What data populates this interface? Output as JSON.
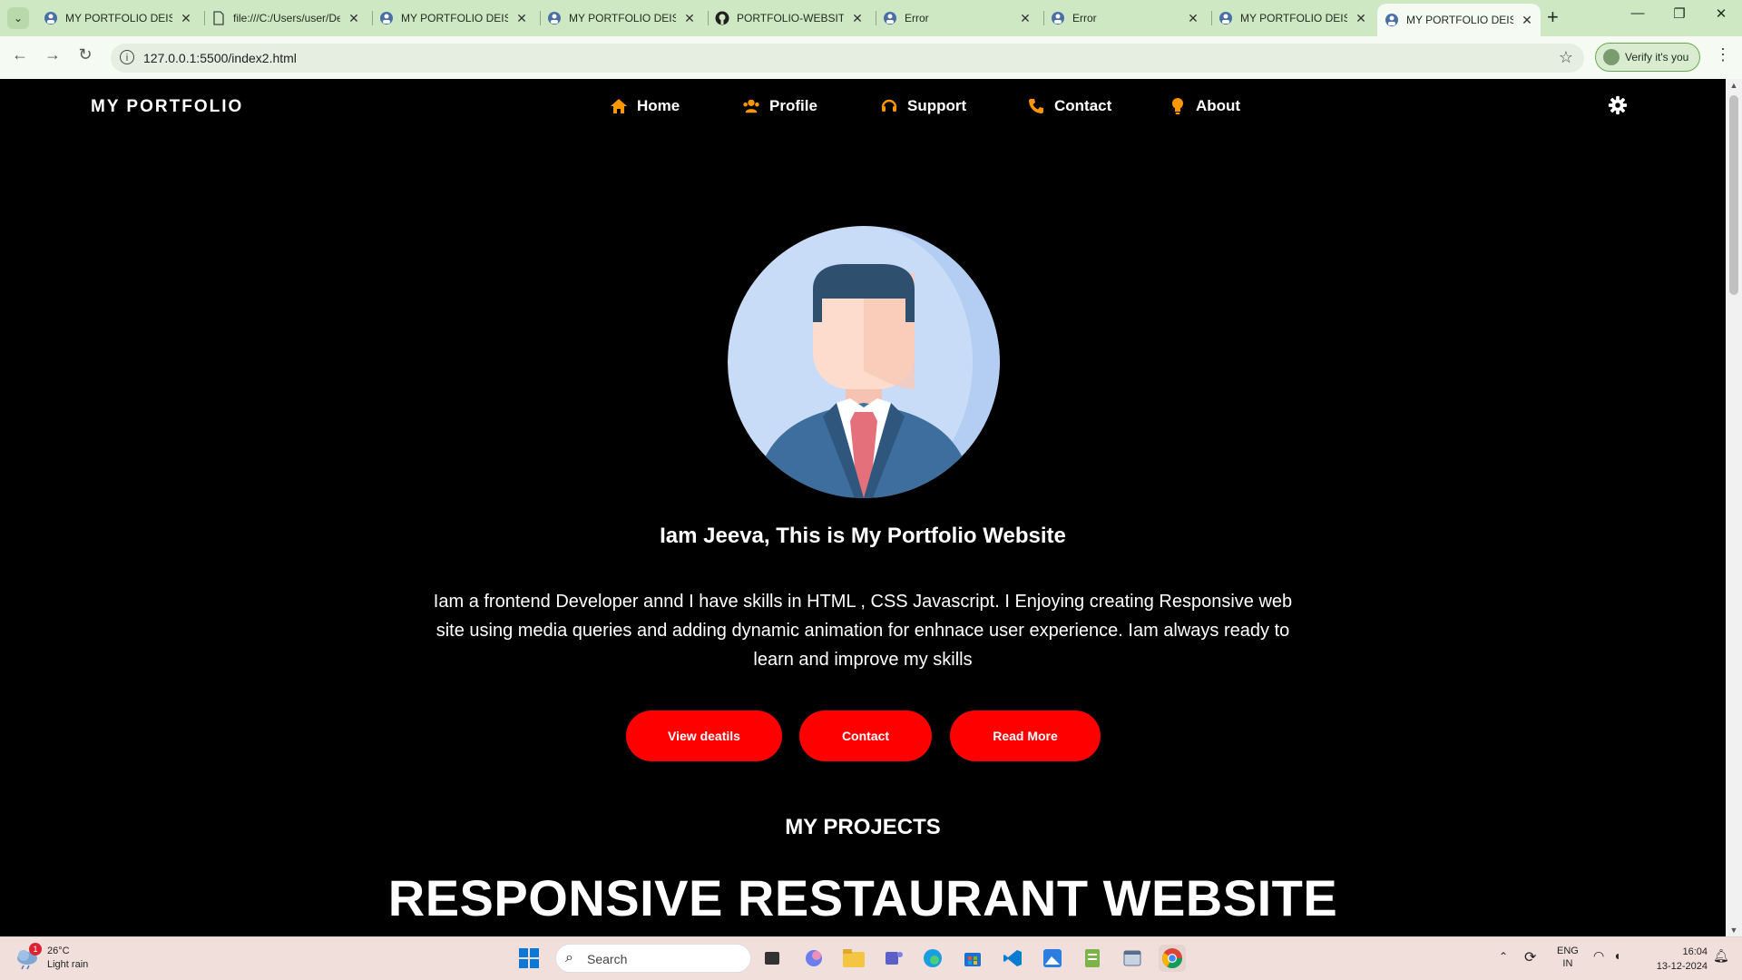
{
  "browser": {
    "tabs": [
      {
        "title": "MY PORTFOLIO DEISGN",
        "icon": "portfolio-favicon"
      },
      {
        "title": "file:///C:/Users/user/Desktop",
        "icon": "file-favicon"
      },
      {
        "title": "MY PORTFOLIO DEISGN",
        "icon": "portfolio-favicon"
      },
      {
        "title": "MY PORTFOLIO DEISGN",
        "icon": "portfolio-favicon"
      },
      {
        "title": "PORTFOLIO-WEBSITE",
        "icon": "github-favicon"
      },
      {
        "title": "Error",
        "icon": "portfolio-favicon"
      },
      {
        "title": "Error",
        "icon": "portfolio-favicon"
      },
      {
        "title": "MY PORTFOLIO DEISGN",
        "icon": "portfolio-favicon"
      },
      {
        "title": "MY PORTFOLIO DEISGN",
        "icon": "portfolio-favicon",
        "active": true
      }
    ],
    "new_tab": "+",
    "url": "127.0.0.1:5500/index2.html",
    "verify_label": "Verify it's you"
  },
  "site": {
    "brand": "MY PORTFOLIO",
    "nav": [
      {
        "label": "Home",
        "icon": "home-icon"
      },
      {
        "label": "Profile",
        "icon": "users-icon"
      },
      {
        "label": "Support",
        "icon": "headset-icon"
      },
      {
        "label": "Contact",
        "icon": "phone-icon"
      },
      {
        "label": "About",
        "icon": "lightbulb-icon"
      }
    ],
    "theme_toggle_icon": "gear-icon",
    "accent": "#ff0000",
    "nav_icon_color": "#ff9800",
    "intro": {
      "title": "Iam Jeeva, This is My Portfolio Website",
      "text": "Iam a frontend Developer annd I have skills in HTML , CSS Javascript. I Enjoying creating Responsive web site using media queries and adding dynamic animation for enhnace user experience. Iam always ready to learn and improve my skills"
    },
    "buttons": [
      "View deatils",
      "Contact",
      "Read More"
    ],
    "projects_heading": "MY PROJECTS",
    "project_title": "RESPONSIVE RESTAURANT WEBSITE"
  },
  "taskbar": {
    "weather": {
      "temp": "26°C",
      "desc": "Light rain",
      "badge": "1"
    },
    "search_label": "Search",
    "lang": {
      "line1": "ENG",
      "line2": "IN"
    },
    "clock": {
      "time": "16:04",
      "date": "13-12-2024"
    }
  }
}
